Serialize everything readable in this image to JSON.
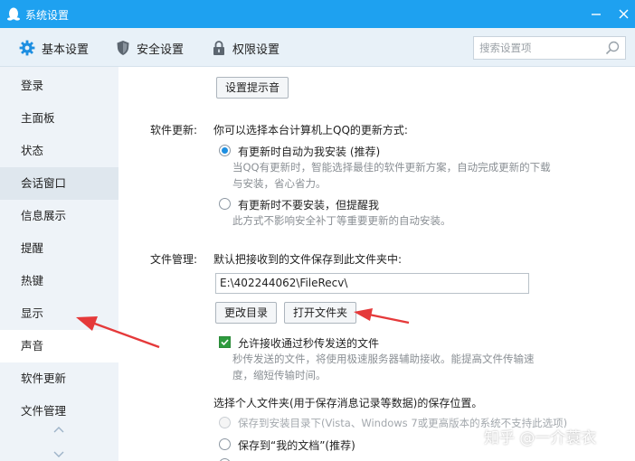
{
  "window": {
    "title": "系统设置"
  },
  "tabs": [
    {
      "label": "基本设置",
      "icon": "gear-icon"
    },
    {
      "label": "安全设置",
      "icon": "shield-icon"
    },
    {
      "label": "权限设置",
      "icon": "lock-icon"
    }
  ],
  "search": {
    "placeholder": "搜索设置项",
    "value": ""
  },
  "sidebar": {
    "items": [
      {
        "label": "登录"
      },
      {
        "label": "主面板"
      },
      {
        "label": "状态"
      },
      {
        "label": "会话窗口"
      },
      {
        "label": "信息展示"
      },
      {
        "label": "提醒"
      },
      {
        "label": "热键"
      },
      {
        "label": "显示"
      },
      {
        "label": "声音"
      },
      {
        "label": "软件更新"
      },
      {
        "label": "文件管理"
      }
    ]
  },
  "main": {
    "set_sound_button": "设置提示音",
    "update": {
      "label": "软件更新:",
      "intro": "你可以选择本台计算机上QQ的更新方式:",
      "option1": "有更新时自动为我安装 (推荐)",
      "option1_desc_line1": "当QQ有更新时，智能选择最佳的软件更新方案，自动完成更新的下载",
      "option1_desc_line2": "与安装，省心省力。",
      "option2": "有更新时不要安装，但提醒我",
      "option2_desc": "此方式不影响安全补丁等重要更新的自动安装。"
    },
    "file": {
      "label": "文件管理:",
      "intro": "默认把接收到的文件保存到此文件夹中:",
      "path": "E:\\402244062\\FileRecv\\",
      "change_dir_button": "更改目录",
      "open_folder_button": "打开文件夹",
      "allow_flash_send": "允许接收通过秒传发送的文件",
      "flash_desc_line1": "秒传发送的文件，将使用极速服务器辅助接收。能提高文件传输速",
      "flash_desc_line2": "度，缩短传输时间。",
      "personal_folder_intro": "选择个人文件夹(用于保存消息记录等数据)的保存位置。",
      "save_option1": "保存到安装目录下(Vista、Windows 7或更高版本的系统不支持此选项)",
      "save_option2": "保存到“我的文档”(推荐)"
    }
  },
  "watermark": "知乎 @一介蓑衣",
  "colors": {
    "titlebar": "#1ea1f0",
    "accent": "#1e8fe1",
    "annotation_arrow": "#e5393a",
    "check": "#2e9b3e"
  }
}
